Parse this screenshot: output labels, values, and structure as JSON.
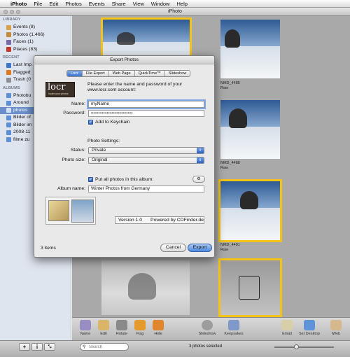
{
  "menubar": {
    "apple": "",
    "app": "iPhoto",
    "items": [
      "File",
      "Edit",
      "Photos",
      "Events",
      "Share",
      "View",
      "Window",
      "Help"
    ]
  },
  "window": {
    "title": "iPhoto"
  },
  "sidebar": {
    "library_header": "LIBRARY",
    "library": [
      {
        "label": "Events (8)",
        "icon": "events-icon"
      },
      {
        "label": "Photos (1.466)",
        "icon": "photos-icon"
      },
      {
        "label": "Faces (1)",
        "icon": "faces-icon"
      },
      {
        "label": "Places (83)",
        "icon": "places-icon"
      }
    ],
    "recent_header": "RECENT",
    "recent": [
      {
        "label": "Last Imp",
        "icon": "last-import-icon"
      },
      {
        "label": "Flagged",
        "icon": "flag-icon"
      },
      {
        "label": "Trash (0",
        "icon": "trash-icon"
      }
    ],
    "albums_header": "ALBUMS",
    "albums": [
      {
        "label": "Photobu",
        "icon": "album-icon"
      },
      {
        "label": "Around",
        "icon": "album-icon"
      },
      {
        "label": "photos",
        "icon": "album-icon",
        "selected": true
      },
      {
        "label": "Bilder of",
        "icon": "album-icon"
      },
      {
        "label": "Bilder im",
        "icon": "album-icon"
      },
      {
        "label": "2008-11",
        "icon": "album-icon"
      },
      {
        "label": "filme zu",
        "icon": "album-icon"
      }
    ]
  },
  "photos": {
    "p2_name": "NMD_4485",
    "p2_type": "Raw",
    "p4_name": "NMD_4488",
    "p4_type": "Raw",
    "p6_name": "NMD_4491",
    "p6_type": "Raw"
  },
  "toolbar": {
    "info": "Name",
    "edit": "Edit",
    "rotate": "Rotate",
    "flag": "Flag",
    "hide": "Hide",
    "slideshow": "Slideshow",
    "keepsakes": "Keepsakes",
    "email": "Email",
    "desktop": "Set Desktop",
    "iweb": "iWeb"
  },
  "bottombar": {
    "add": "+",
    "info": "i",
    "fullscreen": "⤡",
    "search_placeholder": "Search",
    "status": "3 photos selected"
  },
  "dialog": {
    "title": "Export Photos",
    "tabs": [
      "Locr",
      "File Export",
      "Web Page",
      "QuickTime™",
      "Slideshow"
    ],
    "logo_text": "locr",
    "logo_sub": "locate your photos",
    "intro": "Please enter the name and password of your www.locr.com account:",
    "name_label": "Name:",
    "name_value": "myName",
    "password_label": "Password:",
    "password_value": "••••••••••••••••••••••••••••••••••",
    "keychain_label": "Add to Keychain",
    "settings_header": "Photo Settings:",
    "status_label": "Status:",
    "status_value": "Private",
    "size_label": "Photo size:",
    "size_value": "Original",
    "album_check_label": "Put all photos in this album:",
    "album_name_label": "Album name:",
    "album_name_value": "Winter Photos from Germany",
    "version": "Version 1.0",
    "powered": "Powered by CDFinder.de",
    "items": "3 items",
    "cancel": "Cancel",
    "export": "Export"
  },
  "colors": {
    "accent": "#4d8ae0",
    "selection": "#f3c318",
    "sidebar": "#dfe5ee"
  }
}
